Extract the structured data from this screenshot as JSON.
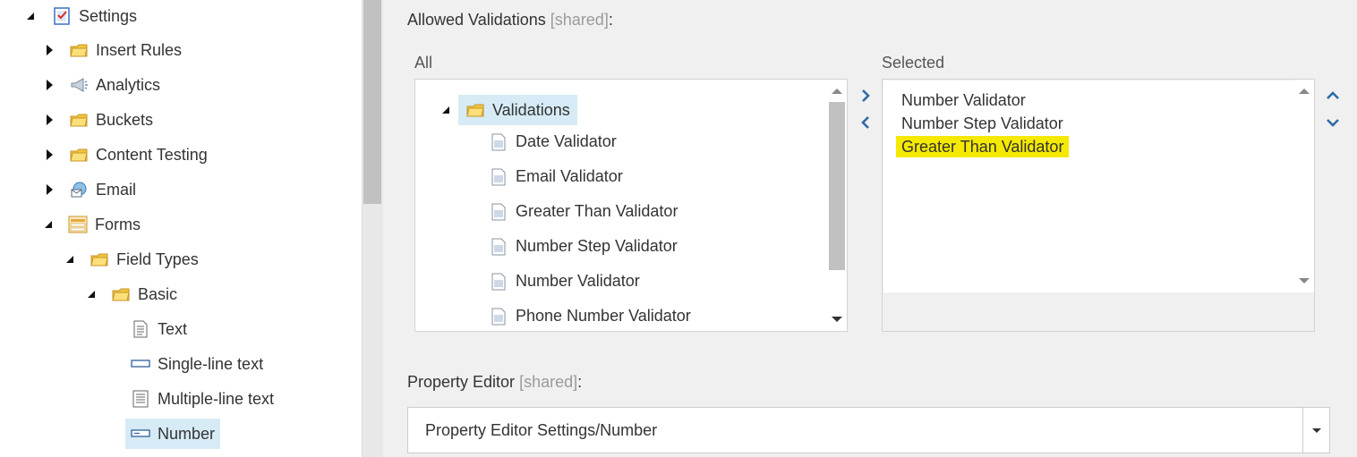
{
  "tree": {
    "items": [
      {
        "label": "Settings",
        "icon": "checklist-icon",
        "expanded": true
      },
      {
        "label": "Insert Rules",
        "icon": "folder-icon",
        "expanded": false
      },
      {
        "label": "Analytics",
        "icon": "megaphone-icon",
        "expanded": false
      },
      {
        "label": "Buckets",
        "icon": "folder-icon",
        "expanded": false
      },
      {
        "label": "Content Testing",
        "icon": "folder-icon",
        "expanded": false
      },
      {
        "label": "Email",
        "icon": "email-globe-icon",
        "expanded": false
      },
      {
        "label": "Forms",
        "icon": "form-icon",
        "expanded": true
      },
      {
        "label": "Field Types",
        "icon": "folder-icon",
        "expanded": true
      },
      {
        "label": "Basic",
        "icon": "folder-icon",
        "expanded": true
      },
      {
        "label": "Text",
        "icon": "text-doc-icon"
      },
      {
        "label": "Single-line text",
        "icon": "single-line-icon"
      },
      {
        "label": "Multiple-line text",
        "icon": "multi-line-icon"
      },
      {
        "label": "Number",
        "icon": "number-field-icon",
        "selected": true
      }
    ]
  },
  "validations": {
    "title": "Allowed Validations",
    "shared_tag": "[shared]",
    "colon": ":",
    "all_label": "All",
    "selected_label": "Selected",
    "all_root": "Validations",
    "all_items": [
      "Date Validator",
      "Email Validator",
      "Greater Than Validator",
      "Number Step Validator",
      "Number Validator",
      "Phone Number Validator"
    ],
    "selected_items": [
      "Number Validator",
      "Number Step Validator",
      "Greater Than Validator"
    ],
    "highlighted_item": "Greater Than Validator",
    "highlight_color": "#f5e900"
  },
  "property_editor": {
    "title": "Property Editor",
    "shared_tag": "[shared]",
    "colon": ":",
    "value": "Property Editor Settings/Number"
  },
  "colors": {
    "selection_bg": "#d6ebf5",
    "chevron_blue": "#2f6aa8",
    "folder_yellow": "#f2c43c"
  }
}
